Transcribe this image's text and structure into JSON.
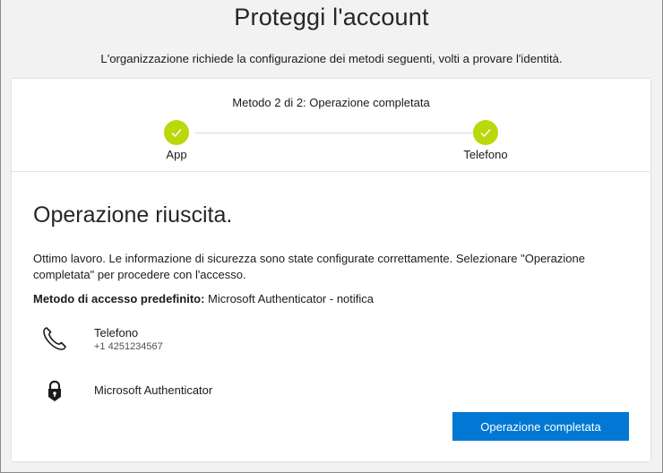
{
  "header": {
    "title": "Proteggi l'account",
    "subtitle": "L'organizzazione richiede la configurazione dei metodi seguenti, volti a provare l'identità."
  },
  "progress": {
    "title": "Metodo 2 di 2: Operazione completata",
    "steps": [
      {
        "label": "App",
        "status": "completed",
        "icon": "check-icon"
      },
      {
        "label": "Telefono",
        "status": "completed",
        "icon": "check-icon"
      }
    ],
    "step_color": "#bad80a"
  },
  "content": {
    "title": "Operazione riuscita.",
    "message": "Ottimo lavoro. Le informazione di sicurezza sono state configurate correttamente. Selezionare \"Operazione completata\" per procedere con l'accesso.",
    "default_method_label": "Metodo di accesso predefinito:",
    "default_method_value": " Microsoft Authenticator - notifica",
    "methods": [
      {
        "name": "Telefono",
        "detail": "+1 4251234567",
        "icon": "phone-icon"
      },
      {
        "name": "Microsoft Authenticator",
        "icon": "authenticator-lock-icon"
      }
    ]
  },
  "actions": {
    "done_label": "Operazione completata",
    "accent_color": "#0078d4"
  }
}
